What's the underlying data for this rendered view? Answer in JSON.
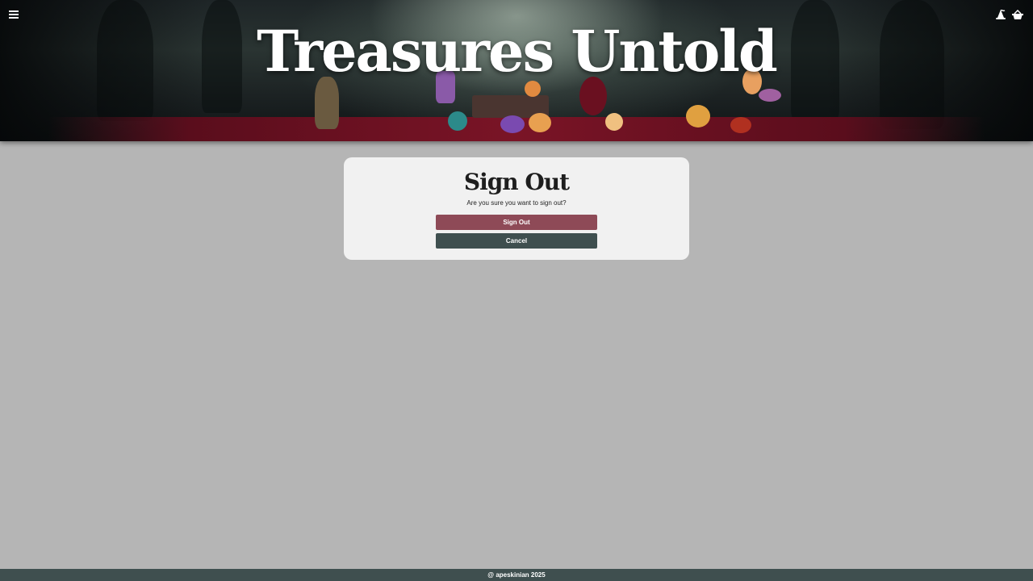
{
  "header": {
    "title": "Treasures Untold",
    "menu_icon": "hamburger-menu-icon",
    "right_icons": [
      "witch-hat-icon",
      "basket-icon"
    ]
  },
  "dialog": {
    "title": "Sign Out",
    "message": "Are you sure you want to sign out?",
    "confirm_label": "Sign Out",
    "cancel_label": "Cancel"
  },
  "footer": {
    "text": "@ apeskinian 2025"
  },
  "colors": {
    "page_background": "#b5b5b5",
    "card_background": "#f1f1f1",
    "confirm_button": "#8e4a57",
    "cancel_button": "#3f4f4f",
    "footer_background": "#3f4f4f"
  }
}
